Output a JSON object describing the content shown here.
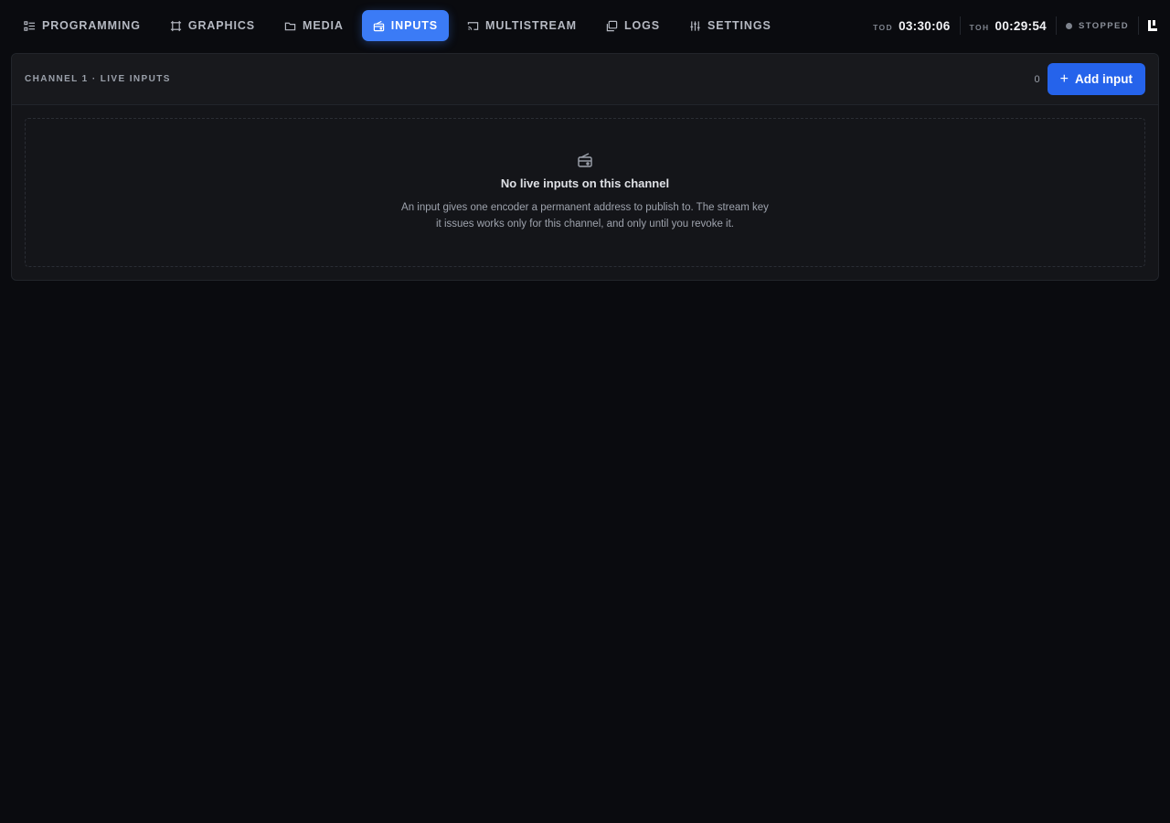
{
  "nav": {
    "tabs": [
      {
        "label": "PROGRAMMING",
        "icon": "list-icon",
        "active": false
      },
      {
        "label": "GRAPHICS",
        "icon": "frame-icon",
        "active": false
      },
      {
        "label": "MEDIA",
        "icon": "folder-icon",
        "active": false
      },
      {
        "label": "INPUTS",
        "icon": "radio-icon",
        "active": true
      },
      {
        "label": "MULTISTREAM",
        "icon": "cast-icon",
        "active": false
      },
      {
        "label": "LOGS",
        "icon": "logs-icon",
        "active": false
      },
      {
        "label": "SETTINGS",
        "icon": "sliders-icon",
        "active": false
      }
    ]
  },
  "status": {
    "tod_label": "TOD",
    "tod_value": "03:30:06",
    "toh_label": "TOH",
    "toh_value": "00:29:54",
    "state": "STOPPED"
  },
  "panel": {
    "title": "CHANNEL 1 · LIVE INPUTS",
    "count": "0",
    "add_label": "Add input",
    "empty_title": "No live inputs on this channel",
    "empty_line1": "An input gives one encoder a permanent address to publish to. The stream key",
    "empty_line2": "it issues works only for this channel, and only until you revoke it."
  },
  "colors": {
    "background": "#0a0b0f",
    "accent": "#2563eb",
    "active_tab": "#3b7bf6"
  }
}
